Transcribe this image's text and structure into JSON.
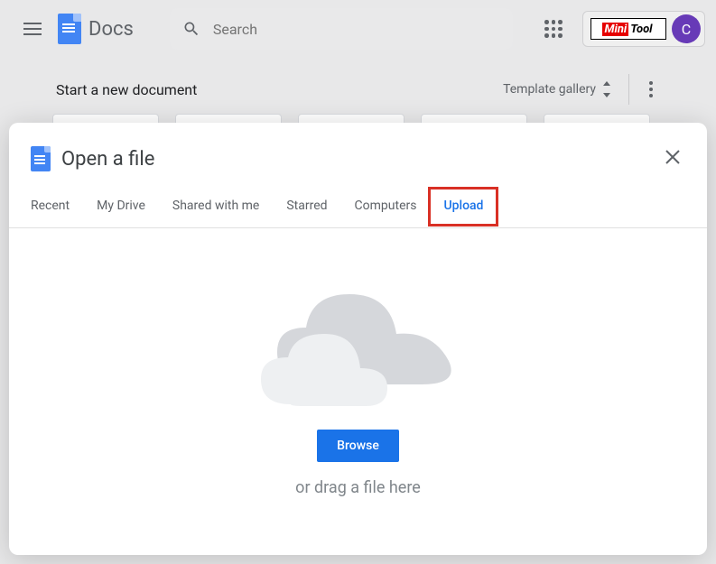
{
  "header": {
    "product_name": "Docs",
    "search_placeholder": "Search",
    "avatar_initial": "C",
    "minitool_text_a": "Mini",
    "minitool_text_b": "Tool"
  },
  "start": {
    "title": "Start a new document",
    "template_gallery_label": "Template gallery"
  },
  "modal": {
    "title": "Open a file",
    "tabs": [
      {
        "id": "recent",
        "label": "Recent"
      },
      {
        "id": "my-drive",
        "label": "My Drive"
      },
      {
        "id": "shared",
        "label": "Shared with me"
      },
      {
        "id": "starred",
        "label": "Starred"
      },
      {
        "id": "computers",
        "label": "Computers"
      },
      {
        "id": "upload",
        "label": "Upload"
      }
    ],
    "active_tab": "upload",
    "browse_label": "Browse",
    "drag_text": "or drag a file here"
  }
}
